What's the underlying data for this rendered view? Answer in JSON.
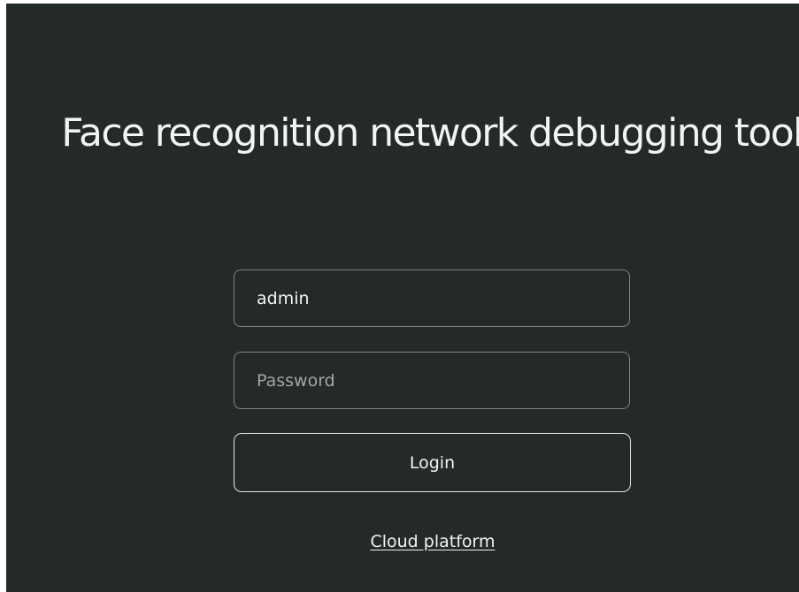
{
  "login": {
    "title": "Face recognition network debugging tool",
    "username_value": "admin",
    "password_placeholder": "Password",
    "login_label": "Login",
    "cloud_link": "Cloud platform"
  },
  "colors": {
    "background": "#242a27",
    "text": "#f2f4f3",
    "field_border": "#7d8581"
  }
}
